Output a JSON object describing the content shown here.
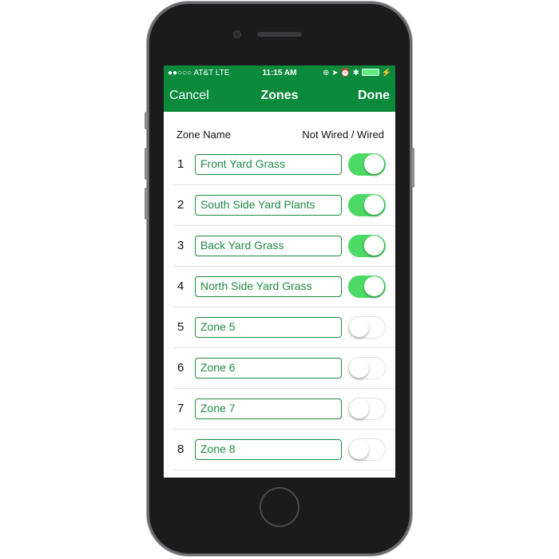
{
  "status": {
    "carrier": "●●○○○ AT&T  LTE",
    "time": "11:15 AM",
    "icons": "⊕ ➤ ⏰ ✱"
  },
  "nav": {
    "cancel": "Cancel",
    "title": "Zones",
    "done": "Done"
  },
  "header": {
    "name": "Zone Name",
    "wired": "Not Wired / Wired"
  },
  "colors": {
    "brand": "#0a8a3a",
    "toggle_on": "#4cd964"
  },
  "zones": [
    {
      "num": "1",
      "name": "Front Yard Grass",
      "wired": true
    },
    {
      "num": "2",
      "name": "South Side Yard Plants",
      "wired": true
    },
    {
      "num": "3",
      "name": "Back Yard Grass",
      "wired": true
    },
    {
      "num": "4",
      "name": "North Side Yard Grass",
      "wired": true
    },
    {
      "num": "5",
      "name": "Zone 5",
      "wired": false
    },
    {
      "num": "6",
      "name": "Zone 6",
      "wired": false
    },
    {
      "num": "7",
      "name": "Zone 7",
      "wired": false
    },
    {
      "num": "8",
      "name": "Zone 8",
      "wired": false
    }
  ]
}
